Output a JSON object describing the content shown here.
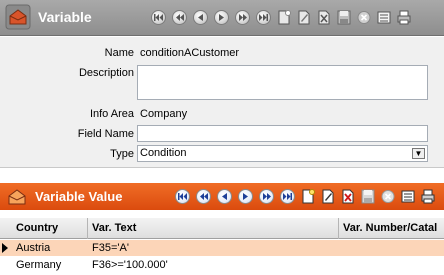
{
  "header": {
    "title": "Variable",
    "icon": "variable-app-icon",
    "nav_icons": [
      "first-record-icon",
      "previous-page-icon",
      "previous-record-icon",
      "next-record-icon",
      "next-page-icon",
      "last-record-icon"
    ],
    "tool_icons": [
      "new-document-icon",
      "edit-icon",
      "delete-icon",
      "save-icon",
      "cancel-icon",
      "list-view-icon",
      "print-icon"
    ]
  },
  "form": {
    "name_label": "Name",
    "name_value": "conditionACustomer",
    "description_label": "Description",
    "description_value": "",
    "info_area_label": "Info Area",
    "info_area_value": "Company",
    "field_name_label": "Field Name",
    "field_name_value": "",
    "type_label": "Type",
    "type_value": "Condition"
  },
  "variable_value": {
    "title": "Variable Value",
    "icon": "variable-value-app-icon",
    "columns": [
      "Country",
      "Var. Text",
      "Var. Number/Catal"
    ],
    "rows": [
      {
        "country": "Austria",
        "var_text": "F35='A'",
        "selected": true
      },
      {
        "country": "Germany",
        "var_text": "F36>='100.000'",
        "selected": false
      }
    ]
  },
  "colors": {
    "header_gray": "#9c9c9c",
    "value_header_orange": "#e65a18",
    "selected_row": "#fcd5b8"
  }
}
